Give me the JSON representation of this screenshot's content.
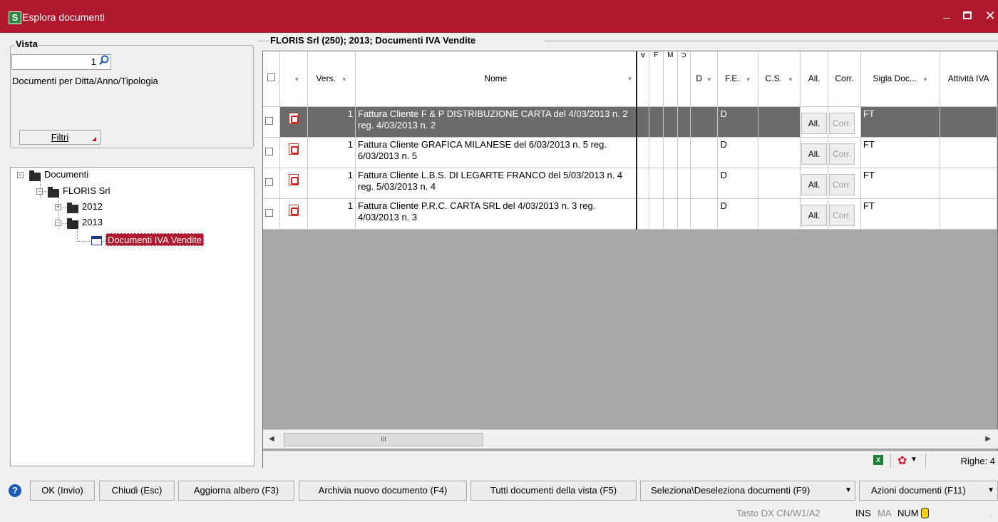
{
  "window": {
    "title": "Esplora documenti",
    "app_icon": "S"
  },
  "vista": {
    "legend": "Vista",
    "value": "1",
    "description": "Documenti per Ditta/Anno/Tipologia",
    "filtri_label": "Filtri"
  },
  "tree": {
    "root": "Documenti",
    "company": "FLORIS Srl",
    "years": [
      "2012",
      "2013"
    ],
    "selected": "Documenti IVA Vendite"
  },
  "grid": {
    "legend": "FLORIS Srl (250); 2013; Documenti IVA Vendite",
    "headers": {
      "vers": "Vers.",
      "nome": "Nome",
      "a": "A",
      "f": "F",
      "m": "M",
      "c": "C",
      "d": "D",
      "fe": "F.E.",
      "cs": "C.S.",
      "all": "All.",
      "corr": "Corr.",
      "sigla": "Sigla Doc...",
      "attivita": "Attività IVA"
    },
    "rows": [
      {
        "vers": "1",
        "nome": "Fattura Cliente F & P DISTRIBUZIONE CARTA del 4/03/2013 n. 2 reg.  4/03/2013 n. 2",
        "d": "D",
        "all": "All.",
        "corr": "Corr.",
        "sigla": "FT"
      },
      {
        "vers": "1",
        "nome": "Fattura Cliente GRAFICA MILANESE del  6/03/2013 n. 5 reg.  6/03/2013 n. 5",
        "d": "D",
        "all": "All.",
        "corr": "Corr.",
        "sigla": "FT"
      },
      {
        "vers": "1",
        "nome": "Fattura Cliente L.B.S. DI LEGARTE FRANCO del 5/03/2013 n. 4 reg.  5/03/2013 n. 4",
        "d": "D",
        "all": "All.",
        "corr": "Corr.",
        "sigla": "FT"
      },
      {
        "vers": "1",
        "nome": "Fattura Cliente P.R.C. CARTA  SRL del  4/03/2013 n. 3 reg.  4/03/2013 n. 3",
        "d": "D",
        "all": "All.",
        "corr": "Corr.",
        "sigla": "FT"
      }
    ],
    "scroll_thumb": "III",
    "righe": "Righe: 4"
  },
  "buttons": {
    "ok": "OK (Invio)",
    "chiudi": "Chiudi (Esc)",
    "aggiorna": "Aggiorna albero (F3)",
    "archivia": "Archivia nuovo documento (F4)",
    "tutti": "Tutti documenti della vista (F5)",
    "seleziona": "Seleziona\\Deseleziona documenti (F9)",
    "azioni": "Azioni documenti (F11)"
  },
  "status": {
    "tasto": "Tasto DX  CN/W1/A2",
    "ins": "INS",
    "ma": "MA",
    "num": "NUM"
  },
  "colors": {
    "titlebar": "#b0182e",
    "selected_row": "#6b6b6b"
  }
}
